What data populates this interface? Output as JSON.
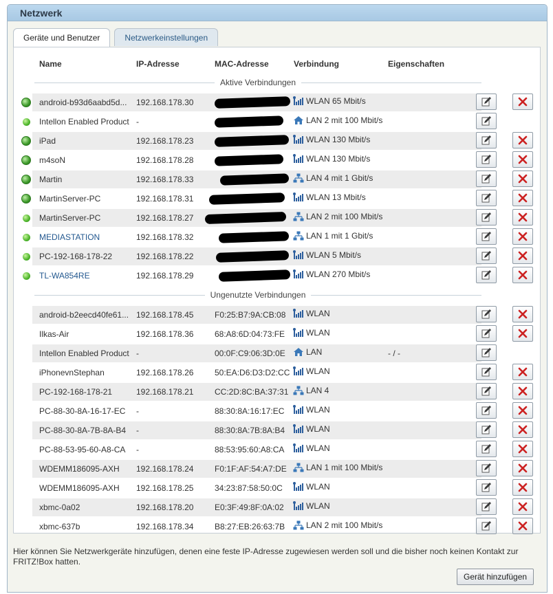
{
  "window": {
    "title": "Netzwerk"
  },
  "tabs": [
    {
      "label": "Geräte und Benutzer",
      "active": true
    },
    {
      "label": "Netzwerkeinstellungen",
      "active": false
    }
  ],
  "columns": {
    "name": "Name",
    "ip": "IP-Adresse",
    "mac": "MAC-Adresse",
    "connection": "Verbindung",
    "properties": "Eigenschaften"
  },
  "sections": {
    "active": "Aktive Verbindungen",
    "unused": "Ungenutzte Verbindungen"
  },
  "active_devices": [
    {
      "name": "android-b93d6aabd5d...",
      "ip": "192.168.178.30",
      "mac": "",
      "connection": "WLAN 65 Mbit/s",
      "conn_icon": "wlan-icon",
      "status_icon": "globe-icon",
      "link": false,
      "deletable": true
    },
    {
      "name": "Intellon Enabled Product",
      "ip": "-",
      "mac": "",
      "connection": "LAN 2 mit 100 Mbit/s",
      "conn_icon": "home-icon",
      "status_icon": "online-dot-icon",
      "link": false,
      "deletable": false
    },
    {
      "name": "iPad",
      "ip": "192.168.178.23",
      "mac": "",
      "connection": "WLAN 130 Mbit/s",
      "conn_icon": "wlan-icon",
      "status_icon": "globe-icon",
      "link": false,
      "deletable": true
    },
    {
      "name": "m4soN",
      "ip": "192.168.178.28",
      "mac": "",
      "connection": "WLAN 130 Mbit/s",
      "conn_icon": "wlan-icon",
      "status_icon": "globe-icon",
      "link": false,
      "deletable": true
    },
    {
      "name": "Martin",
      "ip": "192.168.178.33",
      "mac": "",
      "connection": "LAN 4 mit 1 Gbit/s",
      "conn_icon": "lan-icon",
      "status_icon": "globe-icon",
      "link": false,
      "deletable": true
    },
    {
      "name": "MartinServer-PC",
      "ip": "192.168.178.31",
      "mac": "",
      "connection": "WLAN 13 Mbit/s",
      "conn_icon": "wlan-icon",
      "status_icon": "globe-icon",
      "link": false,
      "deletable": true
    },
    {
      "name": "MartinServer-PC",
      "ip": "192.168.178.27",
      "mac": "",
      "connection": "LAN 2 mit 100 Mbit/s",
      "conn_icon": "lan-icon",
      "status_icon": "online-dot-icon",
      "link": false,
      "deletable": true
    },
    {
      "name": "MEDIASTATION",
      "ip": "192.168.178.32",
      "mac": "",
      "connection": "LAN 1 mit 1 Gbit/s",
      "conn_icon": "lan-icon",
      "status_icon": "online-dot-icon",
      "link": true,
      "deletable": true
    },
    {
      "name": "PC-192-168-178-22",
      "ip": "192.168.178.22",
      "mac": "",
      "connection": "WLAN 5 Mbit/s",
      "conn_icon": "wlan-icon",
      "status_icon": "online-dot-icon",
      "link": false,
      "deletable": true
    },
    {
      "name": "TL-WA854RE",
      "ip": "192.168.178.29",
      "mac": "",
      "connection": "WLAN 270 Mbit/s",
      "conn_icon": "wlan-icon",
      "status_icon": "online-dot-icon",
      "link": true,
      "deletable": true
    }
  ],
  "unused_devices": [
    {
      "name": "android-b2eecd40fe61...",
      "ip": "192.168.178.45",
      "mac": "F0:25:B7:9A:CB:08",
      "connection": "WLAN",
      "conn_icon": "wlan-icon",
      "props": "",
      "deletable": true
    },
    {
      "name": "Ilkas-Air",
      "ip": "192.168.178.36",
      "mac": "68:A8:6D:04:73:FE",
      "connection": "WLAN",
      "conn_icon": "wlan-icon",
      "props": "",
      "deletable": true
    },
    {
      "name": "Intellon Enabled Product",
      "ip": "-",
      "mac": "00:0F:C9:06:3D:0E",
      "connection": "LAN",
      "conn_icon": "home-icon",
      "props": "- / -",
      "deletable": false
    },
    {
      "name": "iPhonevnStephan",
      "ip": "192.168.178.26",
      "mac": "50:EA:D6:D3:D2:CC",
      "connection": "WLAN",
      "conn_icon": "wlan-icon",
      "props": "",
      "deletable": true
    },
    {
      "name": "PC-192-168-178-21",
      "ip": "192.168.178.21",
      "mac": "CC:2D:8C:BA:37:31",
      "connection": "LAN 4",
      "conn_icon": "lan-icon",
      "props": "",
      "deletable": true
    },
    {
      "name": "PC-88-30-8A-16-17-EC",
      "ip": "-",
      "mac": "88:30:8A:16:17:EC",
      "connection": "WLAN",
      "conn_icon": "wlan-icon",
      "props": "",
      "deletable": true
    },
    {
      "name": "PC-88-30-8A-7B-8A-B4",
      "ip": "-",
      "mac": "88:30:8A:7B:8A:B4",
      "connection": "WLAN",
      "conn_icon": "wlan-icon",
      "props": "",
      "deletable": true
    },
    {
      "name": "PC-88-53-95-60-A8-CA",
      "ip": "-",
      "mac": "88:53:95:60:A8:CA",
      "connection": "WLAN",
      "conn_icon": "wlan-icon",
      "props": "",
      "deletable": true
    },
    {
      "name": "WDEMM186095-AXH",
      "ip": "192.168.178.24",
      "mac": "F0:1F:AF:54:A7:DE",
      "connection": "LAN 1 mit 100 Mbit/s",
      "conn_icon": "lan-icon",
      "props": "",
      "deletable": true
    },
    {
      "name": "WDEMM186095-AXH",
      "ip": "192.168.178.25",
      "mac": "34:23:87:58:50:0C",
      "connection": "WLAN",
      "conn_icon": "wlan-icon",
      "props": "",
      "deletable": true
    },
    {
      "name": "xbmc-0a02",
      "ip": "192.168.178.20",
      "mac": "E0:3F:49:8F:0A:02",
      "connection": "WLAN",
      "conn_icon": "wlan-icon",
      "props": "",
      "deletable": true
    },
    {
      "name": "xbmc-637b",
      "ip": "192.168.178.34",
      "mac": "B8:27:EB:26:63:7B",
      "connection": "LAN 2 mit 100 Mbit/s",
      "conn_icon": "lan-icon",
      "props": "",
      "deletable": true
    }
  ],
  "footer": {
    "text": "Hier können Sie Netzwerkgeräte hinzufügen, denen eine feste IP-Adresse zugewiesen werden soll und die bisher noch keinen Kontakt zur FRITZ!Box hatten.",
    "add_button": "Gerät hinzufügen"
  },
  "colors": {
    "titlebar": "#a8c9e4",
    "link": "#23588f",
    "delete": "#cc2222",
    "online": "#4db52a"
  }
}
